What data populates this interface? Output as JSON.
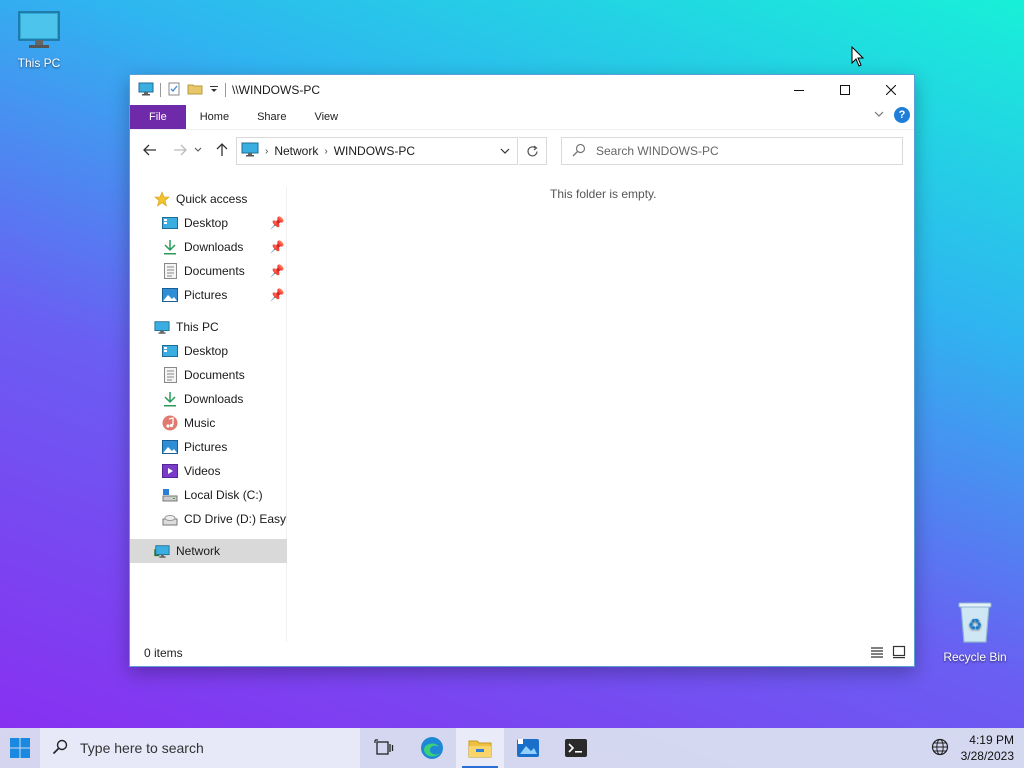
{
  "desktop": {
    "icons": [
      {
        "label": "This PC"
      },
      {
        "label": "Recycle Bin"
      }
    ]
  },
  "window": {
    "title": "\\\\WINDOWS-PC",
    "ribbon_tabs": [
      "File",
      "Home",
      "Share",
      "View"
    ],
    "address": {
      "segments": [
        "Network",
        "WINDOWS-PC"
      ]
    },
    "search": {
      "placeholder": "Search WINDOWS-PC"
    },
    "nav": {
      "quick_access": "Quick access",
      "quick_items": [
        "Desktop",
        "Downloads",
        "Documents",
        "Pictures"
      ],
      "this_pc": "This PC",
      "pc_items": [
        "Desktop",
        "Documents",
        "Downloads",
        "Music",
        "Pictures",
        "Videos",
        "Local Disk (C:)",
        "CD Drive (D:) EasyKMS"
      ],
      "network": "Network"
    },
    "empty_message": "This folder is empty.",
    "status": "0 items"
  },
  "taskbar": {
    "search_placeholder": "Type here to search",
    "time": "4:19 PM",
    "date": "3/28/2023"
  },
  "colors": {
    "file_tab": "#6e2aa8",
    "accent": "#2b6fd6"
  }
}
